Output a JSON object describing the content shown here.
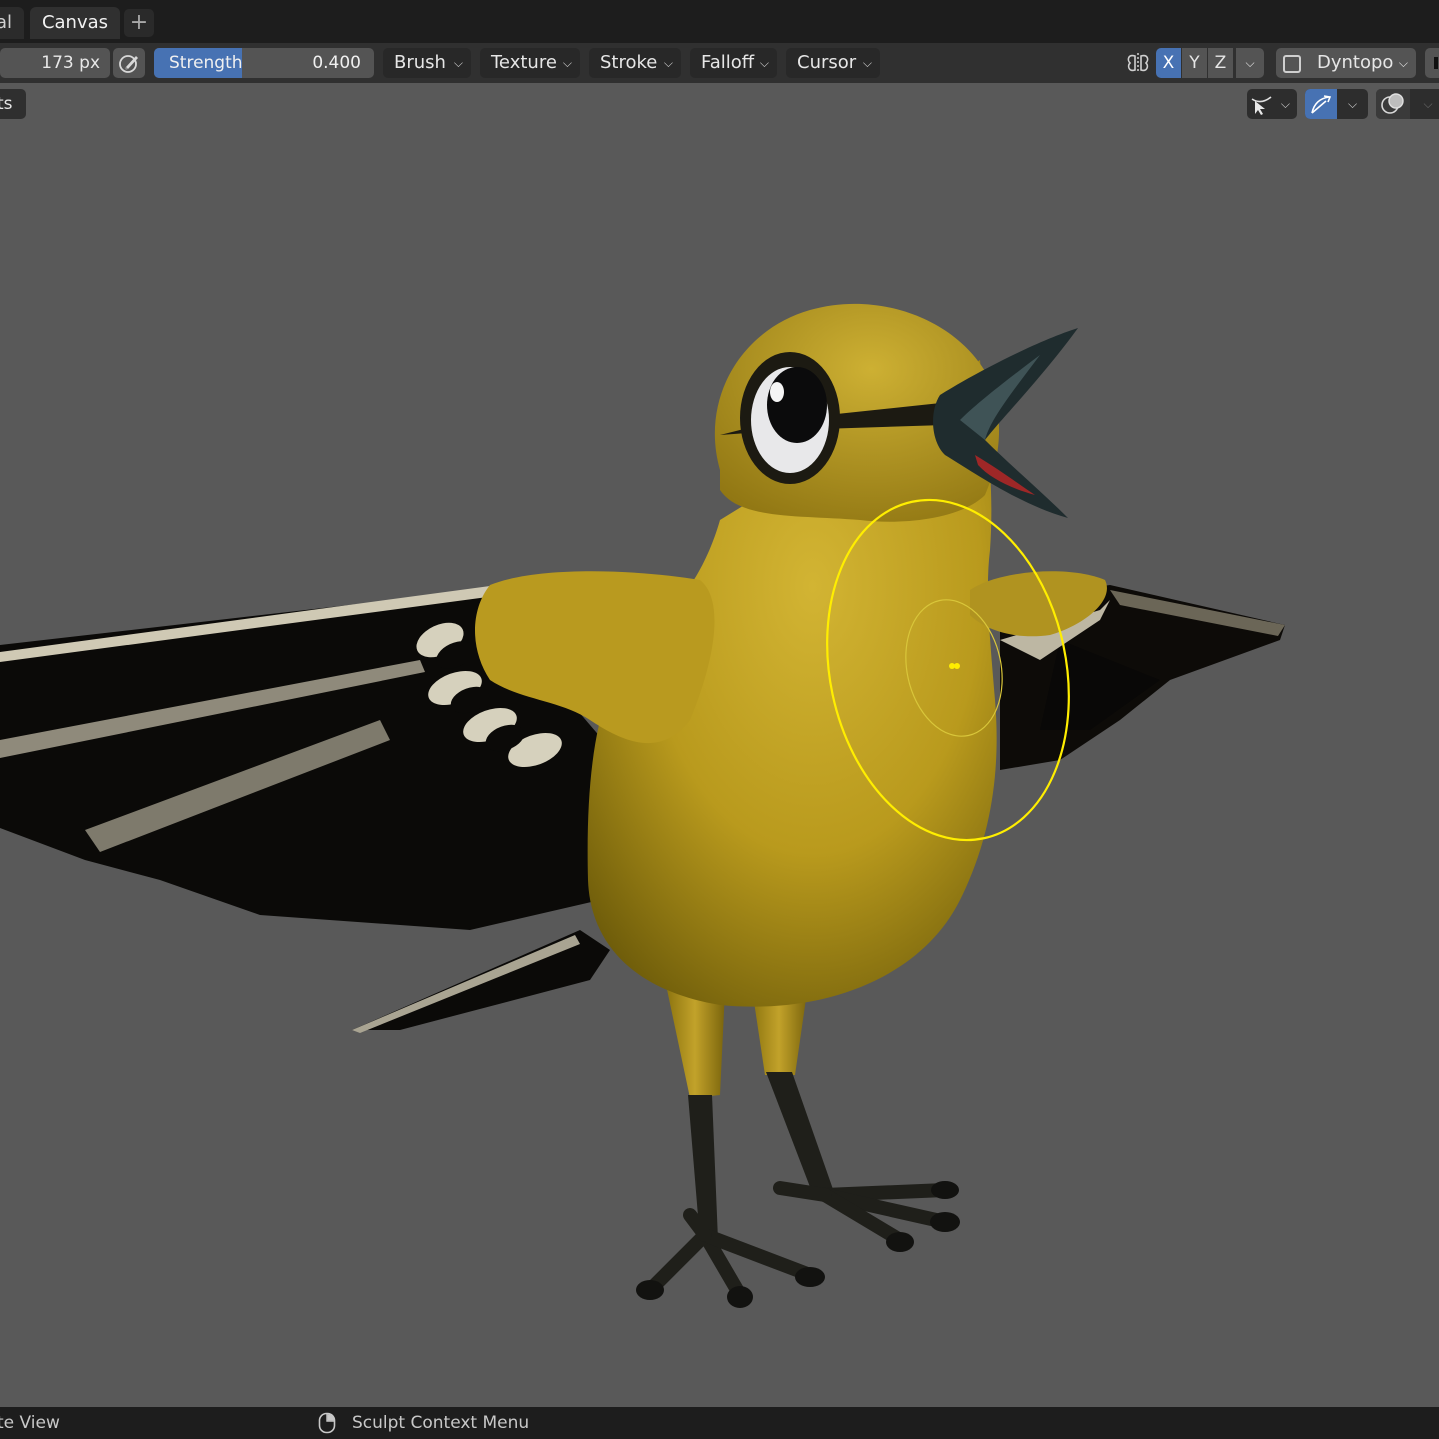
{
  "tabs": {
    "prev_label": "al",
    "active_label": "Canvas",
    "add_label": "+"
  },
  "toolbar": {
    "radius_value": "173 px",
    "strength_label": "Strength",
    "strength_value": "0.400",
    "strength_fraction": 0.4,
    "menus": [
      "Brush",
      "Texture",
      "Stroke",
      "Falloff",
      "Cursor"
    ],
    "axes": [
      {
        "label": "X",
        "active": true
      },
      {
        "label": "Y",
        "active": false
      },
      {
        "label": "Z",
        "active": false
      }
    ],
    "dyntopo_label": "Dyntopo"
  },
  "viewport": {
    "left_chip_label": "ts"
  },
  "status": {
    "left_text": "te View",
    "mid_text": "Sculpt Context Menu"
  },
  "colors": {
    "accent": "#4772b3",
    "brush_cursor": "#ffee00",
    "bird_body": "#c7a82a"
  }
}
